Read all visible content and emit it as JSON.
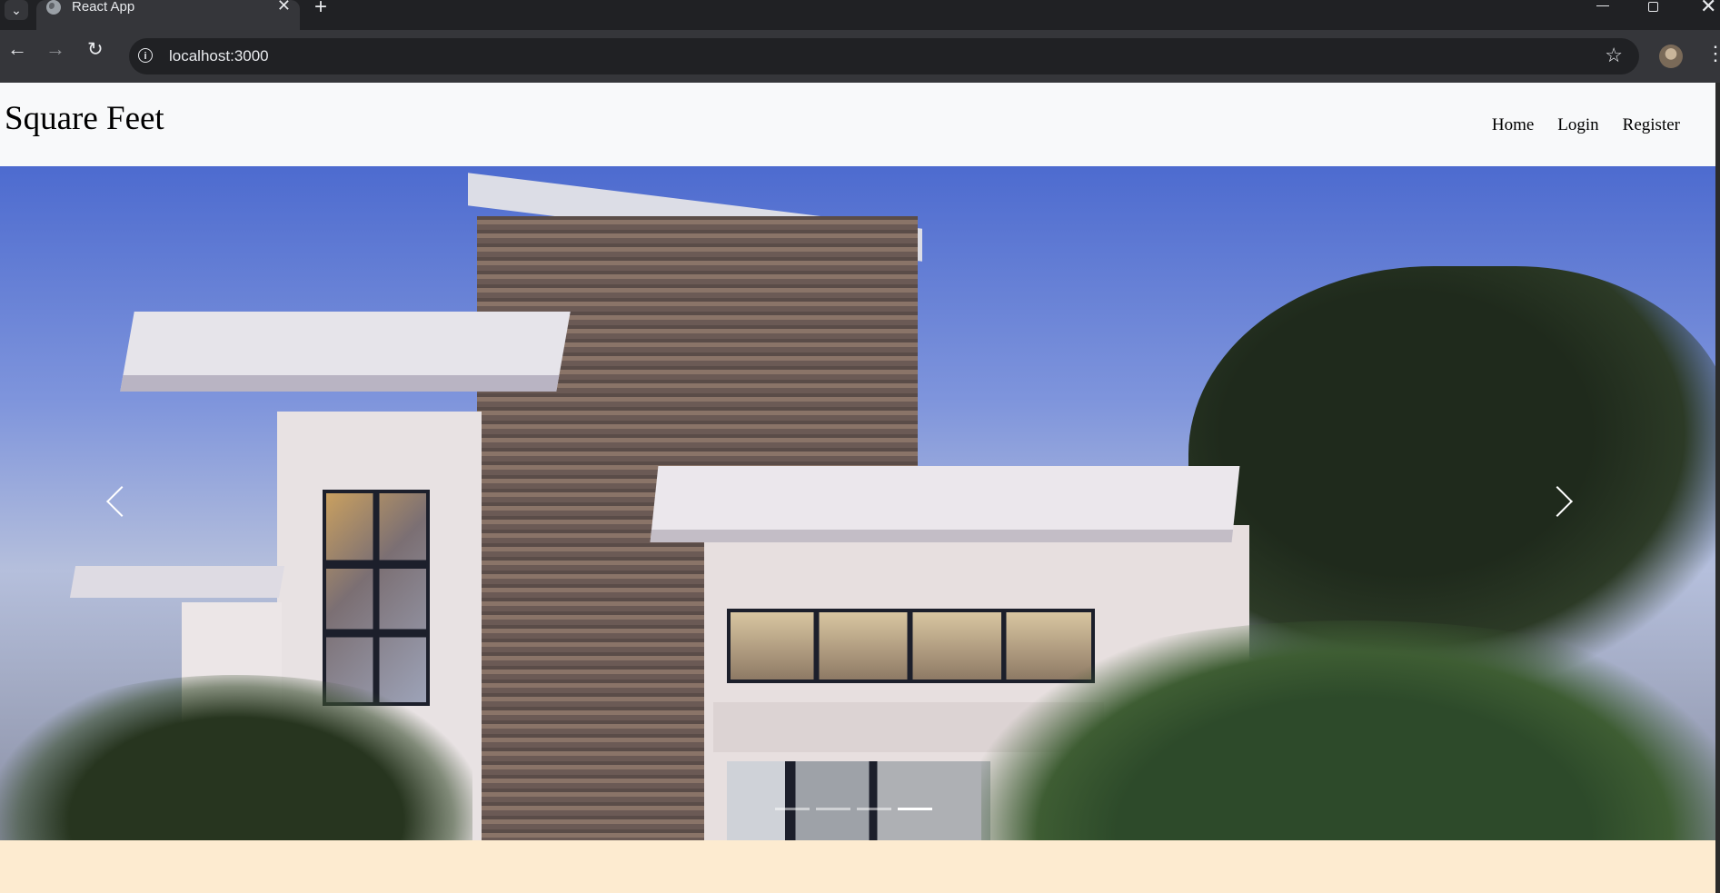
{
  "browser": {
    "tab_title": "React App",
    "tab_close": "✕",
    "new_tab": "+",
    "window_close": "✕",
    "url": "localhost:3000",
    "back": "←",
    "forward": "→",
    "reload": "↻",
    "star": "☆",
    "kebab": "⋮",
    "info": "i",
    "dropdown": "⌄"
  },
  "site": {
    "brand": "Square Feet",
    "nav": [
      "Home",
      "Login",
      "Register"
    ]
  },
  "carousel": {
    "slide_count": 4,
    "active_index": 3,
    "image_description_icon": "modern-house-photo"
  }
}
